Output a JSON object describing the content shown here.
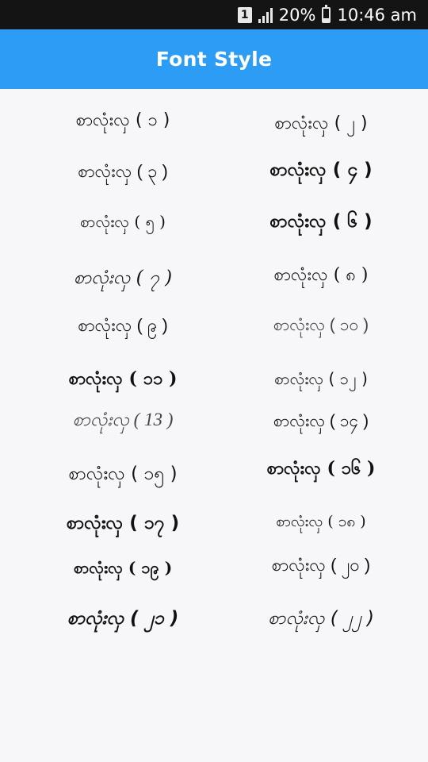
{
  "status_bar": {
    "sim": "1",
    "battery": "20%",
    "battery_level": 0.2,
    "time": "10:46 am"
  },
  "app_bar": {
    "title": "Font Style",
    "color": "#2d9cf5"
  },
  "fonts": [
    {
      "label": "စာလုံးလှ ( ၁ )"
    },
    {
      "label": "စာလုံးလှ ( ၂ )"
    },
    {
      "label": "စာလုံးလှ ( ၃ )"
    },
    {
      "label": "စာလုံးလှ ( ၄ )"
    },
    {
      "label": "စာလုံးလှ ( ၅ )"
    },
    {
      "label": "စာလုံးလှ ( ၆ )"
    },
    {
      "label": "စာလုံးလှ ( ၇ )"
    },
    {
      "label": "စာလုံးလှ ( ၈ )"
    },
    {
      "label": "စာလုံးလှ ( ၉ )"
    },
    {
      "label": "စာလုံးလှ ( ၁၀ )"
    },
    {
      "label": "စာလုံးလှ ( ၁၁ )"
    },
    {
      "label": "စာလုံးလှ ( ၁၂ )"
    },
    {
      "label": "စာလုံးလှ ( 13 )"
    },
    {
      "label": "စာလုံးလှ ( ၁၄ )"
    },
    {
      "label": "စာလုံးလှ ( ၁၅ )"
    },
    {
      "label": "စာလုံးလှ ( ၁၆ )"
    },
    {
      "label": "စာလုံးလှ ( ၁၇ )"
    },
    {
      "label": "စာလုံးလှ ( ၁၈ )"
    },
    {
      "label": "စာလုံးလှ ( ၁၉ )"
    },
    {
      "label": "စာလုံးလှ ( ၂၀ )"
    },
    {
      "label": "စာလုံးလှ ( ၂၁ )"
    },
    {
      "label": "စာလုံးလှ ( ၂၂ )"
    }
  ]
}
